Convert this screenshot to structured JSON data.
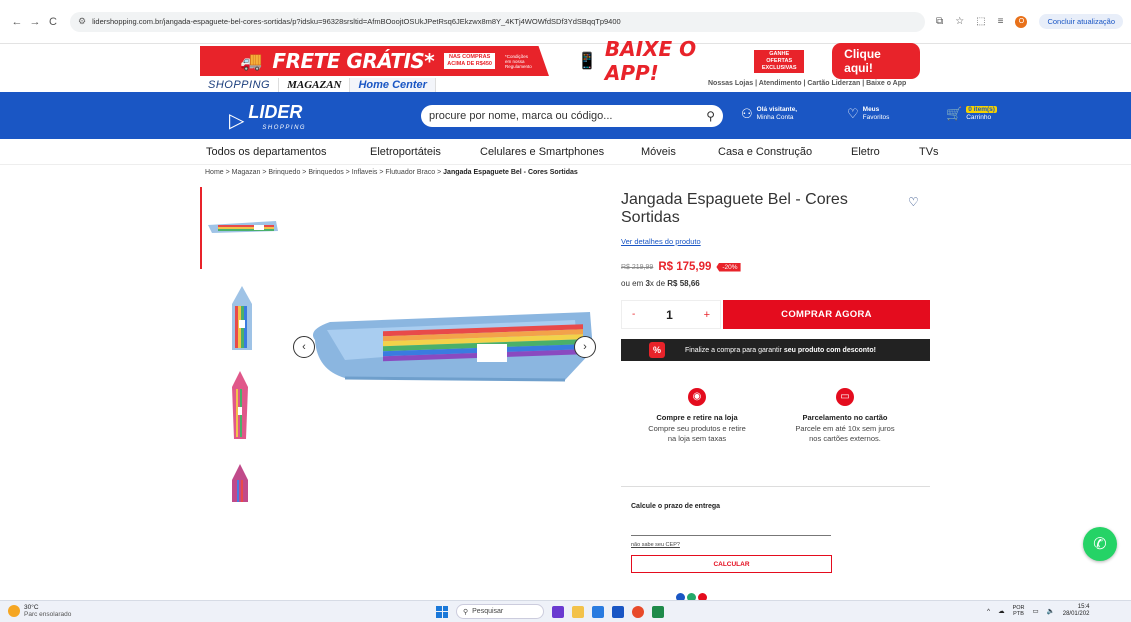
{
  "browser": {
    "back": "←",
    "forward": "→",
    "reload": "C",
    "url": "lidershopping.com.br/jangada-espaguete-bel-cores-sortidas/p?idsku=96328srsltid=AfmBOoojtOSUkJPetRsq6JEkzwx8m8Y_4KTj4WOWfdSDf3YdSBqqTp9400",
    "update_label": "Concluir atualização",
    "profile_initial": "O"
  },
  "promo": {
    "frete_gratis": "FRETE GRÁTIS*",
    "frete_tag_line1": "NAS COMPRAS",
    "frete_tag_line2": "ACIMA DE R$450",
    "frete_small_line1": "*Condições",
    "frete_small_line2": "em nossa",
    "frete_small_line3": "Regulamento",
    "baixe_app": "BAIXE O APP!",
    "ganhe_line1": "GANHE OFERTAS",
    "ganhe_line2": "EXCLUSIVAS",
    "clique_aqui": "Clique aqui!"
  },
  "stores": {
    "shopping": "SHOPPING",
    "magazan": "MAGAZAN",
    "home_center": "Home Center"
  },
  "top_links": "Nossas Lojas | Atendimento | Cartão Liderzan | Baixe o App",
  "header": {
    "logo": "LIDER",
    "logo_sub": "SHOPPING",
    "search_placeholder": "procure por nome, marca ou código...",
    "account_line1": "Olá visitante,",
    "account_line2": "Minha Conta",
    "favorites_line1": "Meus",
    "favorites_line2": "Favoritos",
    "cart_badge": "0 item(s)",
    "cart_label": "Carrinho"
  },
  "categories": [
    "Todos os departamentos",
    "Eletroportáteis",
    "Celulares e Smartphones",
    "Móveis",
    "Casa e Construção",
    "Eletro",
    "TVs"
  ],
  "breadcrumb": {
    "path": "Home > Magazan > Brinquedo > Brinquedos > Inflaveis > Flutuador Braco > ",
    "current": "Jangada Espaguete Bel - Cores Sortidas"
  },
  "product": {
    "title": "Jangada Espaguete Bel - Cores Sortidas",
    "details_link": "Ver detalhes do produto",
    "old_price": "R$ 219,99",
    "new_price": "R$ 175,99",
    "discount": "-20%",
    "installments_prefix": "ou em ",
    "installments_count": "3",
    "installments_mid": "x de ",
    "installments_value": "R$ 58,66",
    "quantity": "1",
    "qty_minus": "-",
    "qty_plus": "+",
    "buy_label": "COMPRAR AGORA",
    "promo_pct": "%",
    "promo_text_a": "Finalize a compra para garantir ",
    "promo_text_b": "seu produto com desconto!"
  },
  "benefits": [
    {
      "title": "Compre e retire na loja",
      "line1": "Compre seu produtos e retire",
      "line2": "na loja sem taxas"
    },
    {
      "title": "Parcelamento no cartão",
      "line1": "Parcele em até 10x sem juros",
      "line2": "nos cartões externos."
    }
  ],
  "shipping": {
    "label": "Calcule o prazo de entrega",
    "cep_link": "não sabe seu CEP?",
    "calc_label": "CALCULAR"
  },
  "taskbar": {
    "temp": "30°C",
    "weather": "Parc ensolarado",
    "search": "Pesquisar",
    "lang1": "POR",
    "lang2": "PTB",
    "time": "15:4",
    "date": "28/01/202"
  },
  "colors": {
    "brand_blue": "#1a56c4",
    "accent_red": "#e40c1e",
    "whatsapp": "#25d366"
  }
}
